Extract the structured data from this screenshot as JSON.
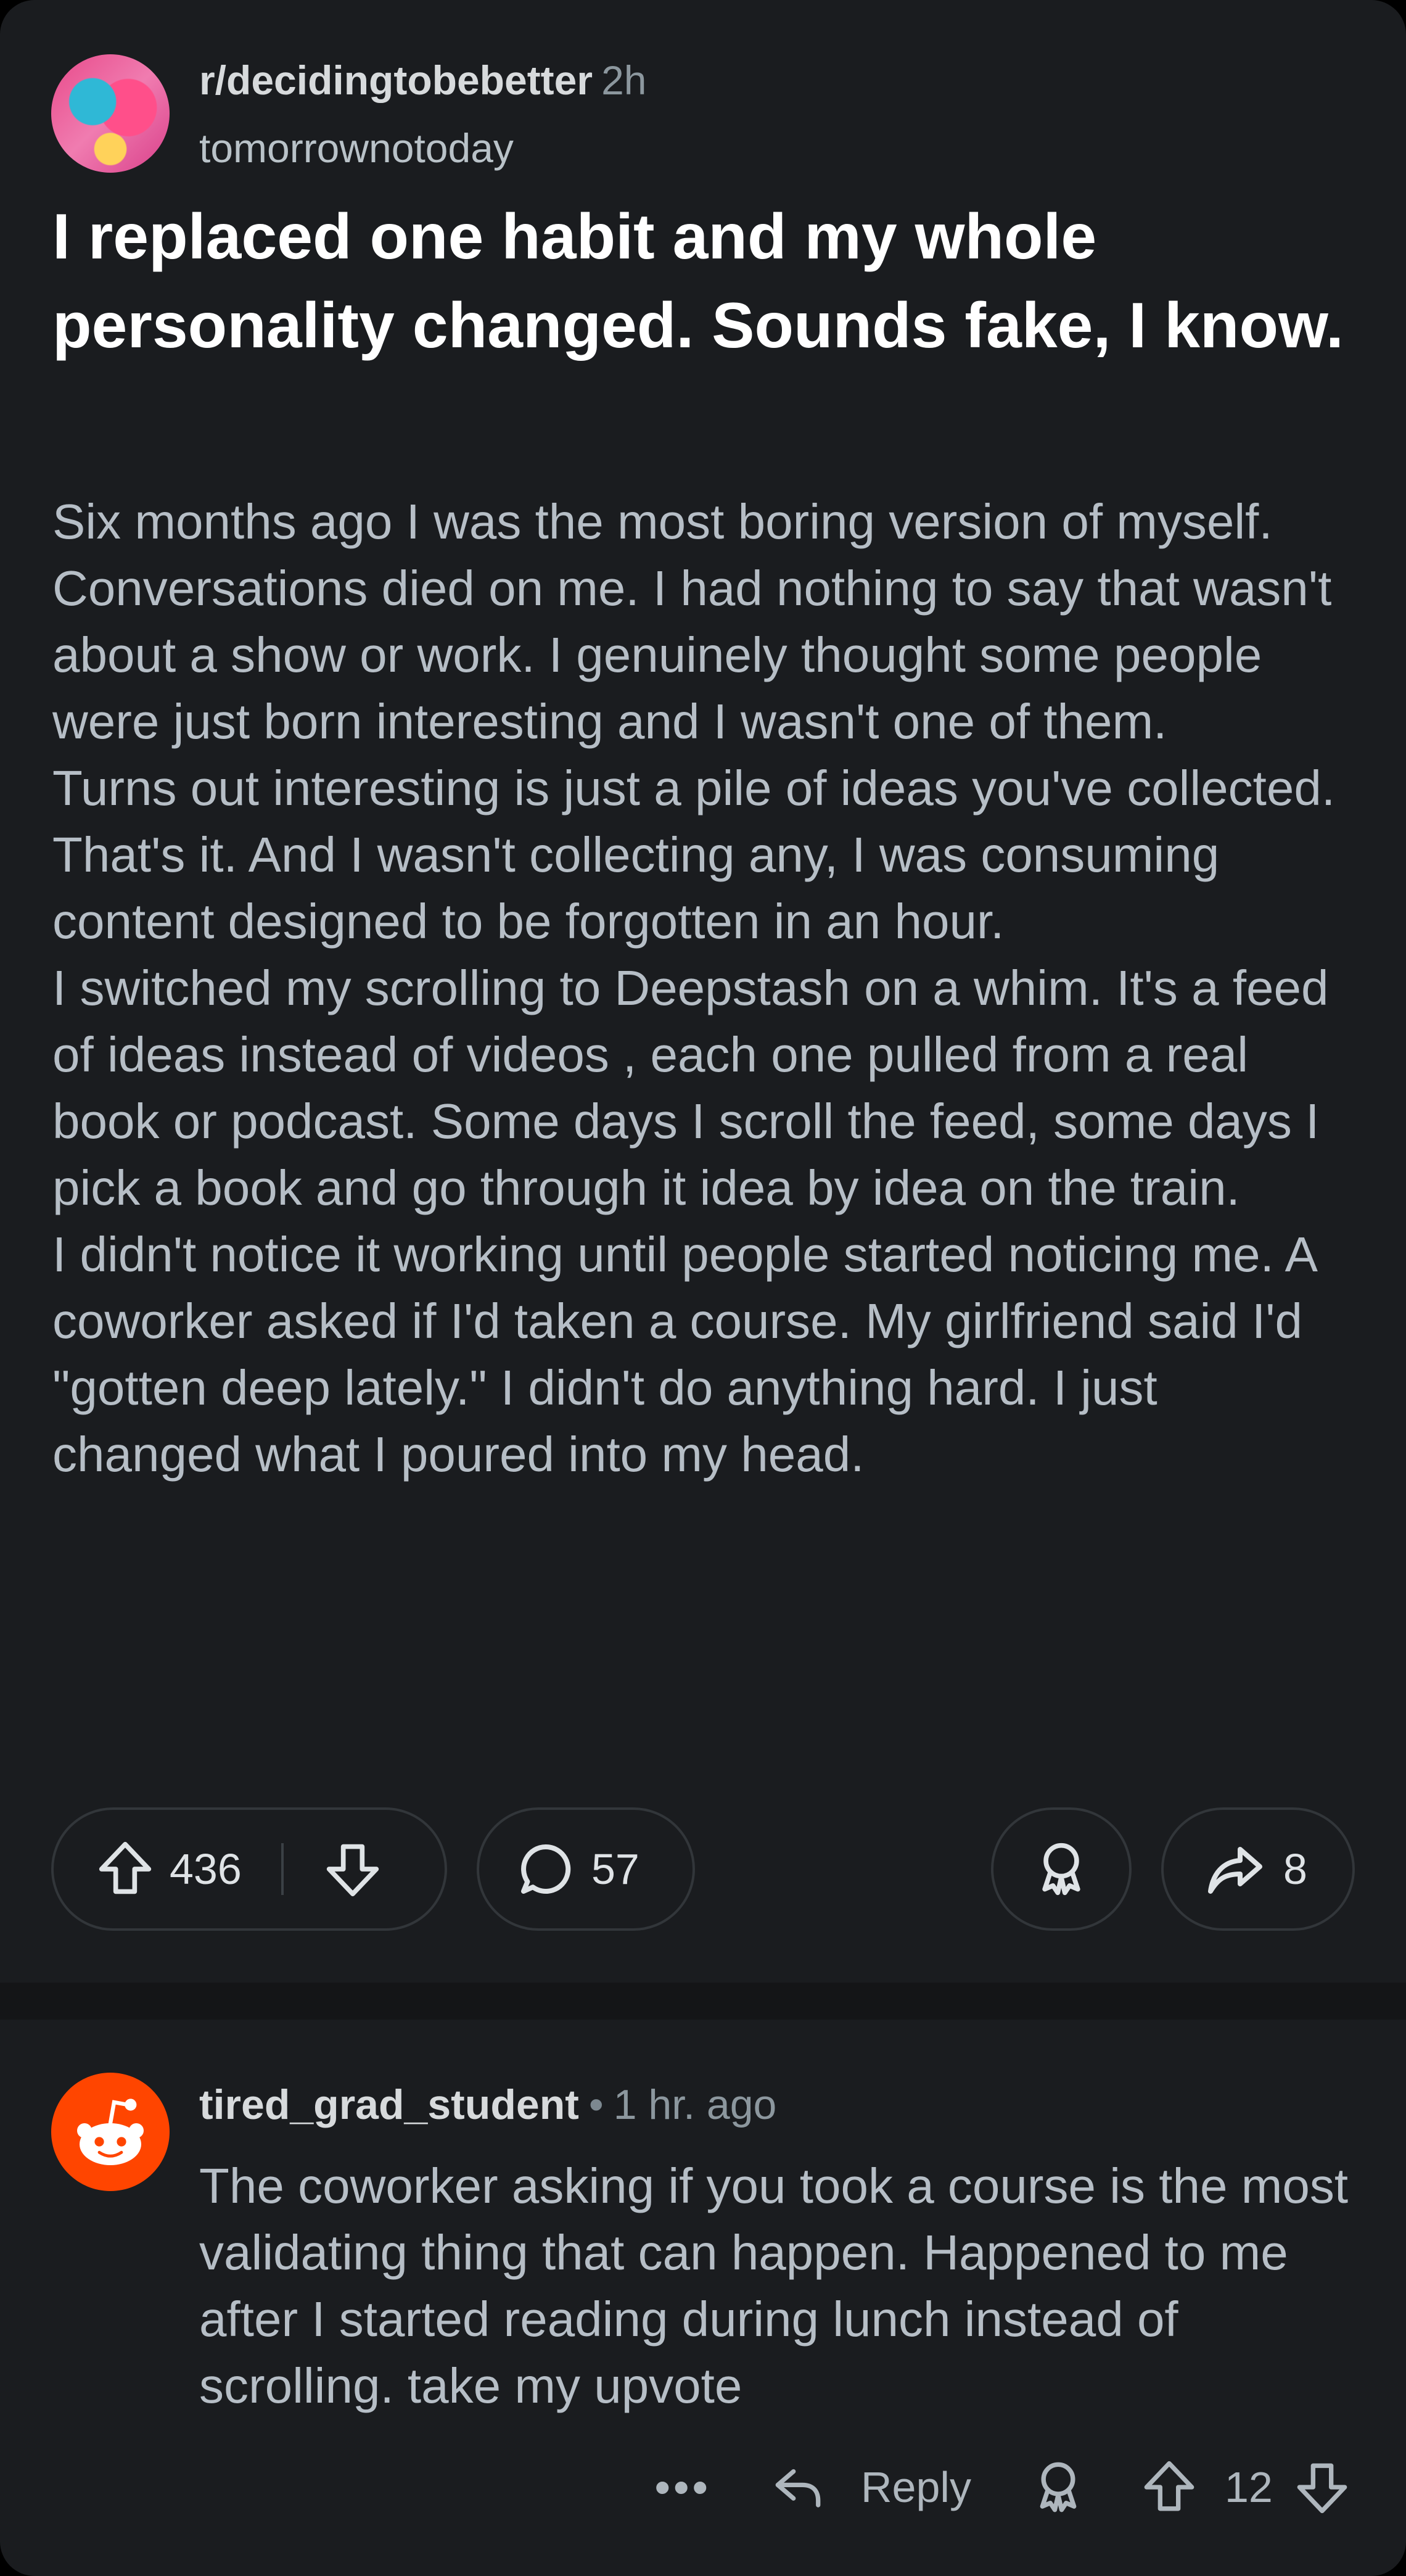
{
  "post": {
    "subreddit": "r/decidingtobebetter",
    "time": "2h",
    "author": "tomorrownotoday",
    "title": "I replaced one habit and my whole personality changed. Sounds fake, I know.",
    "body": [
      "Six months ago I was the most boring version of myself. Conversations died on me. I had nothing to say that wasn't about a show or work. I genuinely thought some people were just born interesting and I wasn't one of them.",
      "Turns out interesting is just a pile of ideas you've collected. That's it. And I wasn't collecting any, I was consuming content designed to be forgotten in an hour.",
      "I switched my scrolling to Deepstash on a whim. It's a feed of ideas instead of videos , each one pulled from a real book or podcast. Some days I scroll the feed, some days I pick a book and go through it idea by idea on the train.",
      "I didn't notice it working until people started noticing me. A coworker asked if I'd taken a course. My girlfriend said I'd \"gotten deep lately.\" I didn't do anything hard. I just changed what I poured into my head."
    ],
    "score": "436",
    "comments": "57",
    "shares": "8"
  },
  "comment": {
    "user": "tired_grad_student",
    "separator": "•",
    "time": "1 hr. ago",
    "text": "The coworker asking if you took a course is the most validating thing that can happen. Happened to me after I started reading during lunch instead of scrolling. take my upvote",
    "more": "•••",
    "reply_label": "Reply",
    "score": "12"
  },
  "icons": {
    "upvote": "upvote-arrow-icon",
    "downvote": "downvote-arrow-icon",
    "comment": "speech-bubble-icon",
    "award": "award-ribbon-icon",
    "share": "share-arrow-icon",
    "reply": "reply-arrow-icon",
    "snoo": "reddit-snoo-icon"
  },
  "colors": {
    "background": "#1a1c1f",
    "snoo_orange": "#ff4500",
    "text": "#b6bec6"
  }
}
